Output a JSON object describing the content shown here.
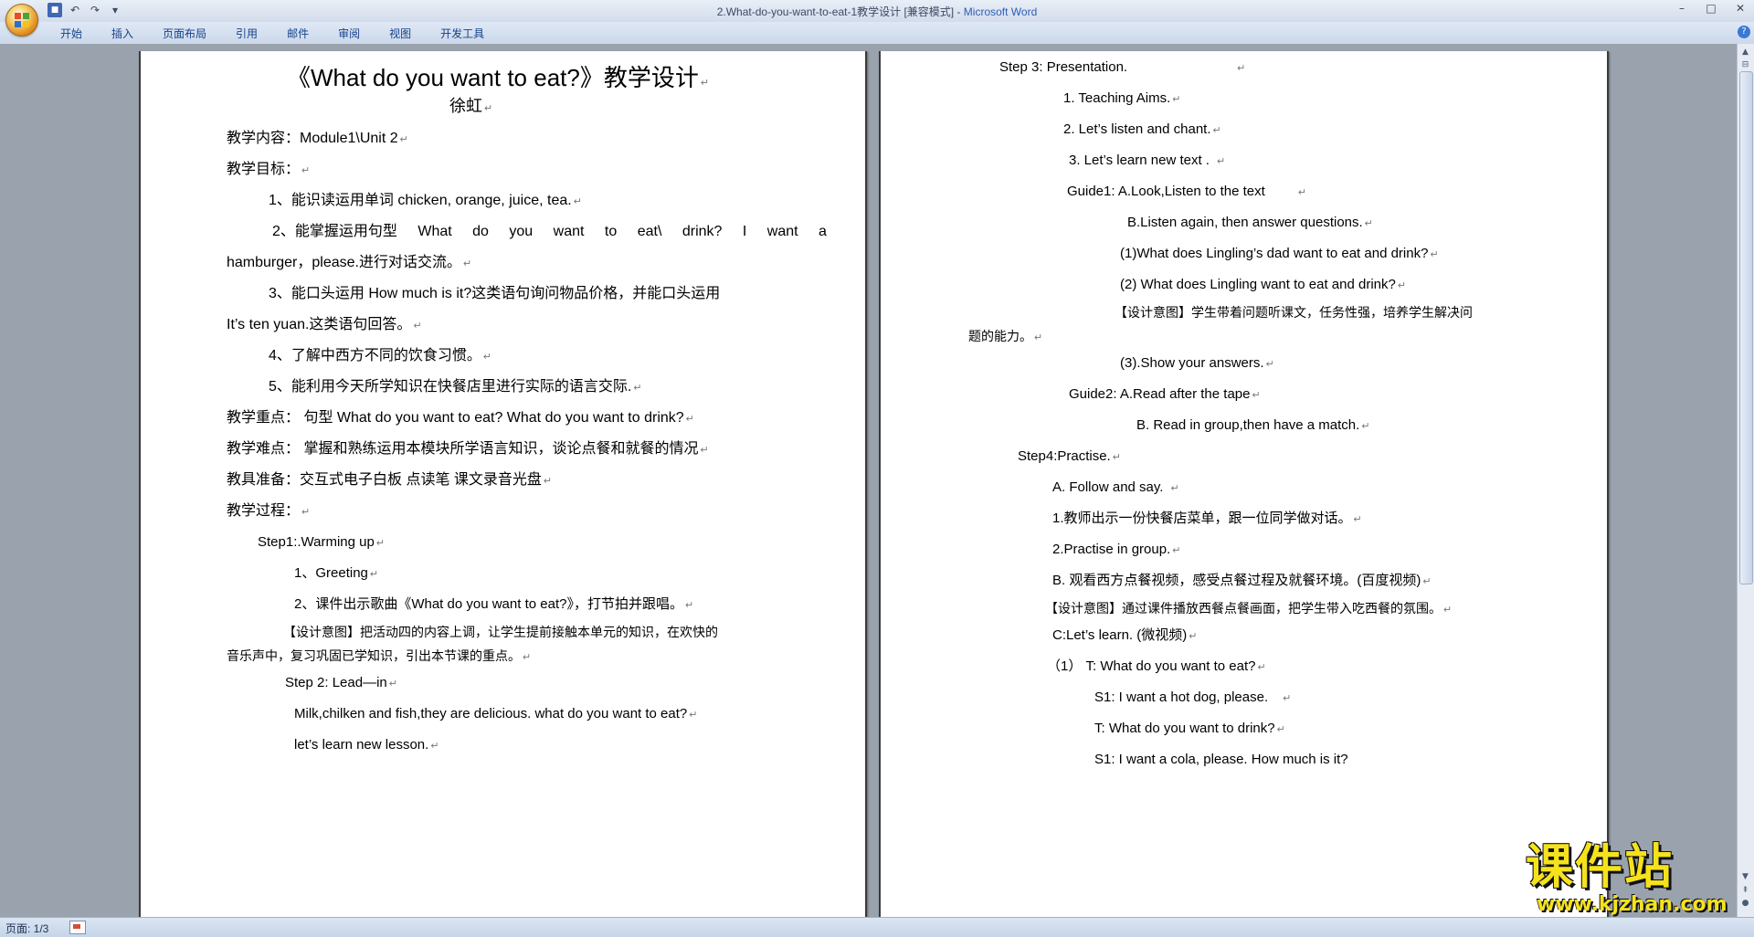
{
  "window": {
    "title_doc": "2.What-do-you-want-to-eat-1教学设计 [兼容模式] - ",
    "title_app": "Microsoft Word"
  },
  "quick_access": {
    "save_icon": "save-icon",
    "undo_icon": "undo-icon",
    "redo_icon": "redo-icon",
    "customize_icon": "customize-icon"
  },
  "ribbon": {
    "tabs": [
      "开始",
      "插入",
      "页面布局",
      "引用",
      "邮件",
      "审阅",
      "视图",
      "开发工具"
    ]
  },
  "left_page": {
    "title": "《What do you want to eat?》教学设计",
    "author": "徐虹",
    "lines": [
      "教学内容：Module1\\Unit 2",
      "教学目标：",
      "1、能识读运用单词 chicken, orange, juice, tea.",
      "2、能掌握运用句型  What  do  you  want  to  eat\\  drink?  I  want  a",
      "hamburger，please.进行对话交流。",
      "3、能口头运用 How much is it?这类语句询问物品价格，并能口头运用",
      "It’s ten yuan.这类语句回答。",
      "4、了解中西方不同的饮食习惯。",
      "5、能利用今天所学知识在快餐店里进行实际的语言交际.",
      "教学重点：  句型 What do you want to eat? What do you want to drink?",
      "教学难点：  掌握和熟练运用本模块所学语言知识，谈论点餐和就餐的情况",
      "教具准备：交互式电子白板    点读笔      课文录音光盘",
      "教学过程：",
      "Step1:.Warming up",
      "1、Greeting",
      "2、课件出示歌曲《What do you want to eat?》，打节拍并跟唱。",
      "【设计意图】把活动四的内容上调，让学生提前接触本单元的知识，在欢快的",
      "音乐声中，复习巩固已学知识，引出本节课的重点。",
      "Step 2: Lead—in",
      "Milk,chilken and fish,they are delicious.  what do you want to eat?",
      "let’s learn new lesson."
    ],
    "justified_line_words": [
      "2、能掌握运用句型",
      "What",
      "do",
      "you",
      "want",
      "to",
      "eat\\",
      "drink?",
      "I",
      "want",
      "a"
    ]
  },
  "right_page": {
    "lines": [
      "Step 3: Presentation.",
      "1.    Teaching Aims.",
      "2. Let’s listen and chant.",
      "3. Let’s learn new text .",
      "Guide1: A.Look,Listen to the text",
      "B.Listen again, then answer questions.",
      "(1)What does Lingling’s dad want to eat and drink?",
      "(2) What does Lingling want to eat and drink?",
      "【设计意图】学生带着问题听课文，任务性强，培养学生解决问",
      "题的能力。",
      "(3).Show your answers.",
      "Guide2:    A.Read after the tape",
      "B. Read in group,then have a match.",
      "Step4:Practise.",
      "A.   Follow and say.",
      "1.教师出示一份快餐店菜单，跟一位同学做对话。",
      "2.Practise in group.",
      "B.  观看西方点餐视频，感受点餐过程及就餐环境。(百度视频)",
      "【设计意图】通过课件播放西餐点餐画面，把学生带入吃西餐的氛围。",
      "C:Let’s learn. (微视频)",
      "（1）    T: What do you want to eat?",
      "S1: I want a hot dog, please.",
      "T: What do you want to drink?",
      "S1: I want a cola, please.        How much is it?"
    ]
  },
  "status_bar": {
    "page_indicator": "页面: 1/3"
  },
  "watermark": {
    "main": "课件站",
    "url": "www.kjzhan.com"
  },
  "marks": {
    "paragraph": "↵"
  }
}
